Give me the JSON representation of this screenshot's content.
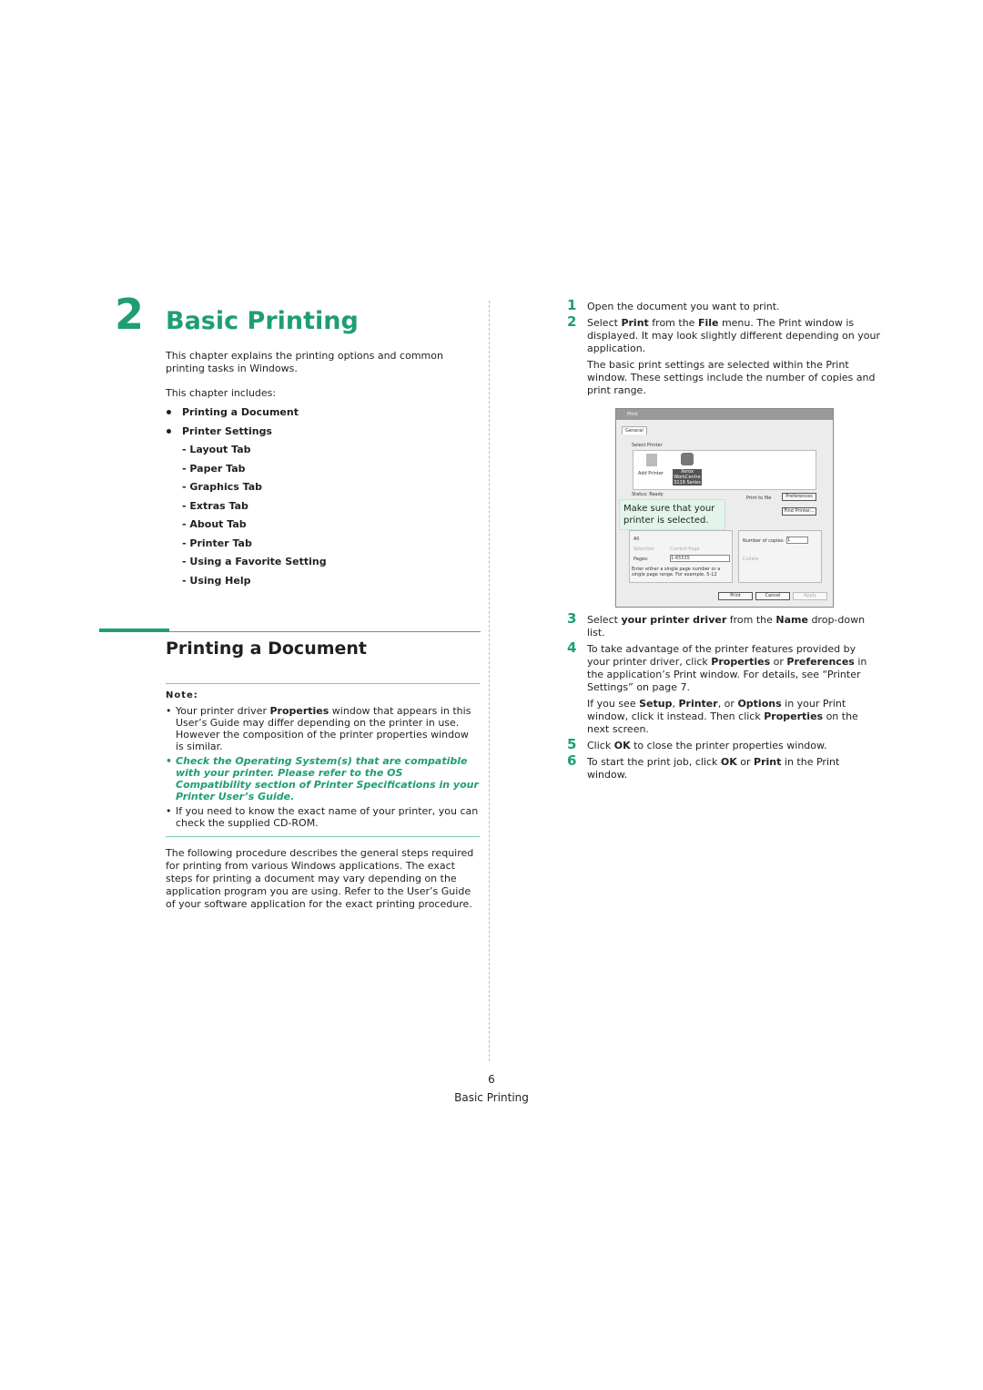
{
  "chapter": {
    "number": "2",
    "title": "Basic Printing",
    "intro": "This chapter explains the printing options and common printing tasks in Windows.",
    "includes_label": "This chapter includes:",
    "toc": [
      {
        "label": "Printing a Document",
        "level": 1
      },
      {
        "label": "Printer Settings",
        "level": 1
      },
      {
        "label": "- Layout Tab",
        "level": 2
      },
      {
        "label": "- Paper Tab",
        "level": 2
      },
      {
        "label": "- Graphics Tab",
        "level": 2
      },
      {
        "label": "- Extras Tab",
        "level": 2
      },
      {
        "label": "- About Tab",
        "level": 2
      },
      {
        "label": "- Printer Tab",
        "level": 2
      },
      {
        "label": "- Using a Favorite Setting",
        "level": 2
      },
      {
        "label": "- Using Help",
        "level": 2
      }
    ]
  },
  "section": {
    "title": "Printing a Document",
    "note_heading": "Note:",
    "notes": [
      "Your printer driver <b>Properties</b> window that appears in this User’s Guide may differ depending on the printer in use. However the composition of the printer properties window is similar.",
      "Check the Operating System(s) that are compatible with your printer. Please refer to the OS Compatibility section of Printer Specifications in your Printer User’s Guide.",
      "If you need to know the exact name of your printer, you can check the supplied CD-ROM."
    ],
    "procedure": "The following procedure describes the general steps required for printing from various Windows applications. The exact steps for printing a document may vary depending on the application program you are using. Refer to the User’s Guide of your software application for the exact printing procedure."
  },
  "steps": [
    {
      "n": "1",
      "paras": [
        "Open the document you want to print."
      ]
    },
    {
      "n": "2",
      "paras": [
        "Select <b>Print</b> from the <b>File</b> menu. The Print window is displayed. It may look slightly different depending on your application.",
        "The basic print settings are selected within the Print window. These settings include the number of copies and print range."
      ]
    },
    {
      "n": "3",
      "paras": [
        "Select <b>your printer driver</b> from the <b>Name</b> drop-down list."
      ]
    },
    {
      "n": "4",
      "paras": [
        "To take advantage of the printer features provided by your printer driver, click <b>Properties</b> or <b>Preferences</b> in the application’s Print window. For details, see “Printer Settings” on page 7.",
        "If you see <b>Setup</b>, <b>Printer</b>, or <b>Options</b> in your Print window, click it instead. Then click <b>Properties</b> on the next screen."
      ]
    },
    {
      "n": "5",
      "paras": [
        "Click <b>OK</b> to close the printer properties window."
      ]
    },
    {
      "n": "6",
      "paras": [
        "To start the print job, click <b>OK</b> or <b>Print</b> in the Print window."
      ]
    }
  ],
  "dialog": {
    "title": "Print",
    "tab": "General",
    "group": "Select Printer",
    "add_printer": "Add Printer",
    "selected_printer": "Xerox WorkCentre 3119 Series",
    "status": "Status: Ready",
    "print_to_file": "Print to file",
    "preferences": "Preferences",
    "find_printer": "Find Printer...",
    "all": "All",
    "selection": "Selection",
    "current_page": "Current Page",
    "pages": "Pages:",
    "pages_value": "1-65535",
    "range_hint": "Enter either a single page number or a single page range. For example, 5-12",
    "copies_label": "Number of copies:",
    "copies_value": "1",
    "collate": "Collate",
    "print": "Print",
    "cancel": "Cancel",
    "apply": "Apply",
    "callout": "Make sure that your printer is selected."
  },
  "footer": {
    "page": "6",
    "label": "Basic Printing"
  },
  "colors": {
    "accent": "#1f9e72"
  }
}
